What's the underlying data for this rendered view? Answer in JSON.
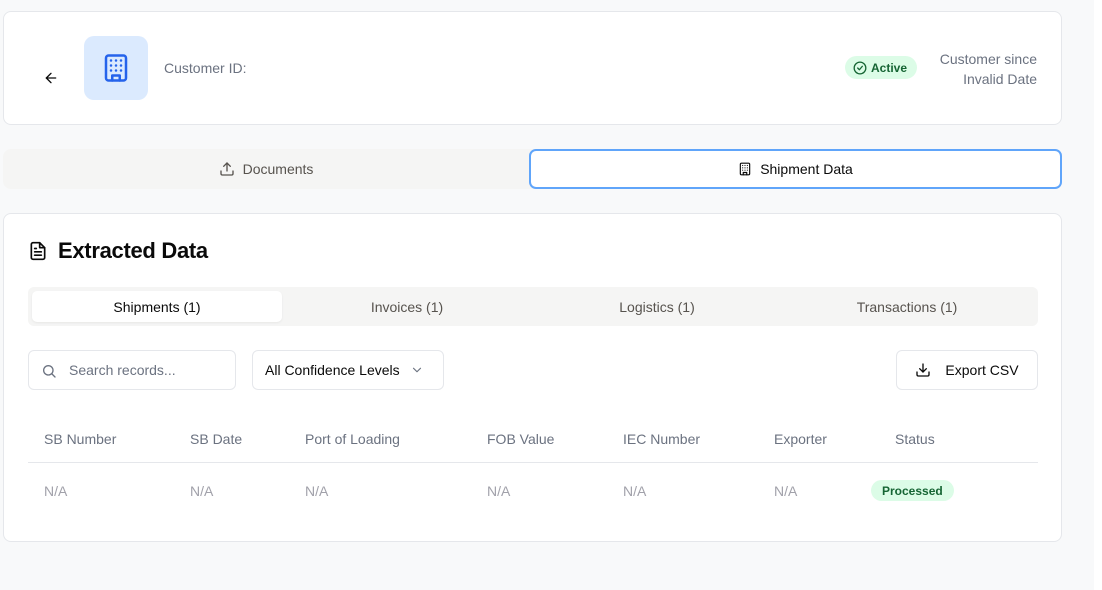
{
  "header": {
    "customer_id_label": "Customer ID:",
    "status": "Active",
    "customer_since_label": "Customer since",
    "customer_since_value": "Invalid Date"
  },
  "main_tabs": [
    {
      "label": "Documents",
      "icon": "upload-icon",
      "active": false
    },
    {
      "label": "Shipment Data",
      "icon": "building-icon",
      "active": true
    }
  ],
  "extracted": {
    "title": "Extracted Data",
    "sub_tabs": [
      {
        "label": "Shipments (1)",
        "active": true
      },
      {
        "label": "Invoices (1)",
        "active": false
      },
      {
        "label": "Logistics (1)",
        "active": false
      },
      {
        "label": "Transactions (1)",
        "active": false
      }
    ],
    "search_placeholder": "Search records...",
    "confidence_select": "All Confidence Levels",
    "export_label": "Export CSV",
    "columns": [
      "SB Number",
      "SB Date",
      "Port of Loading",
      "FOB Value",
      "IEC Number",
      "Exporter",
      "Status"
    ],
    "rows": [
      [
        "N/A",
        "N/A",
        "N/A",
        "N/A",
        "N/A",
        "N/A",
        "Processed"
      ]
    ]
  },
  "colors": {
    "accent_blue": "#2563eb",
    "active_tab_border": "#60a5fa",
    "success_bg": "#dcfce7",
    "success_text": "#166534"
  }
}
